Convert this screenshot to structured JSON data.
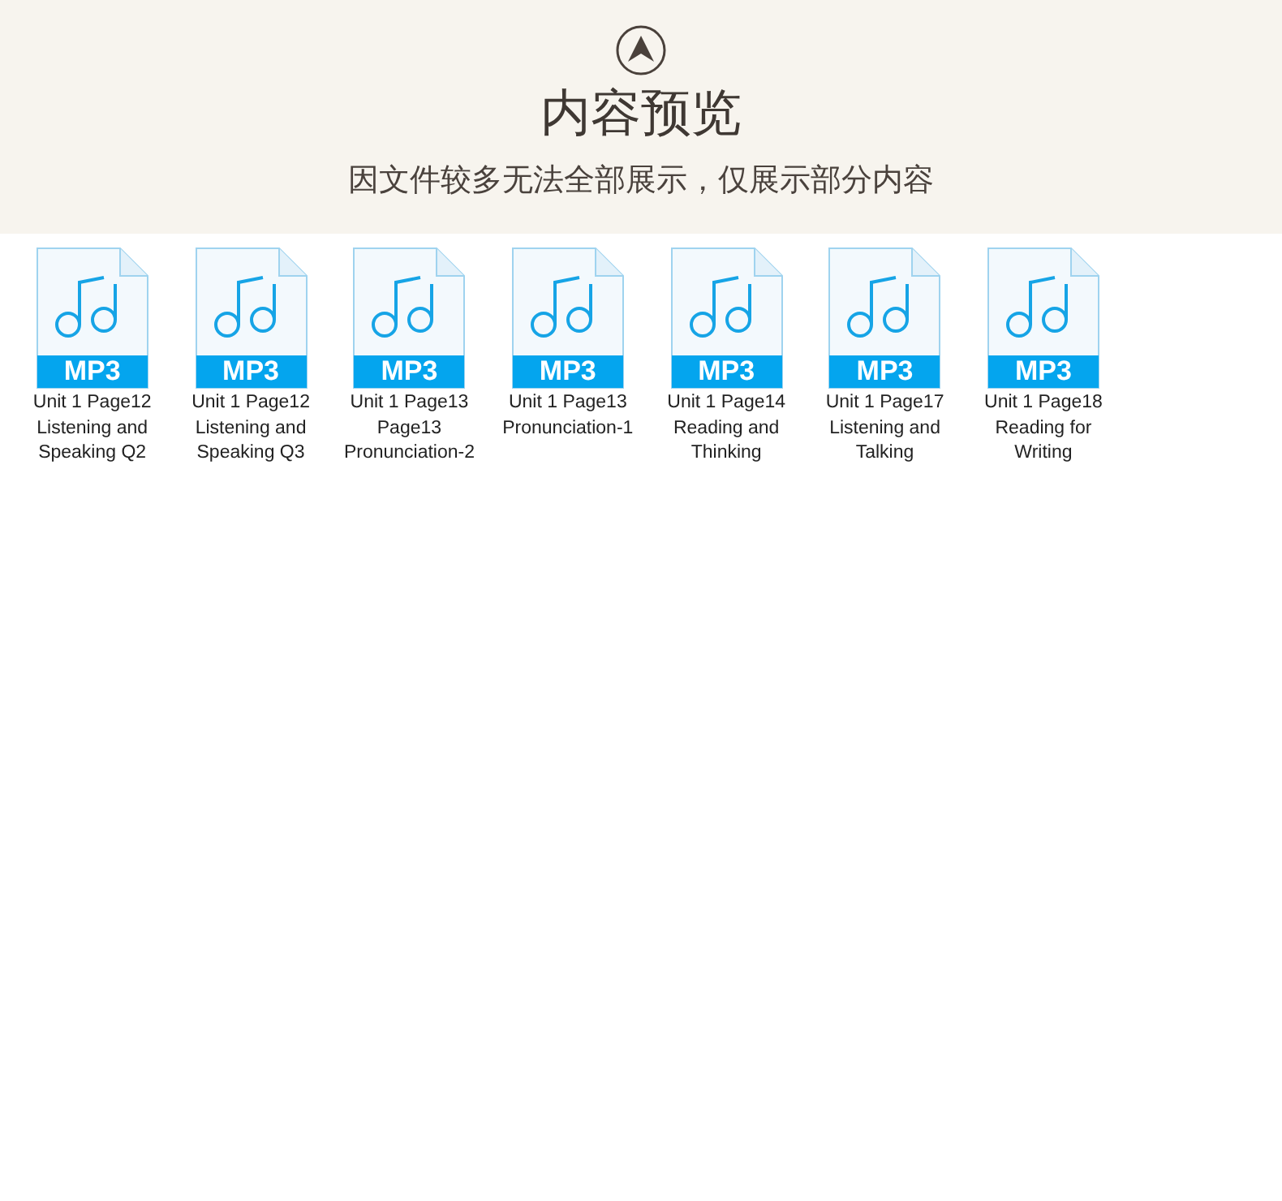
{
  "header": {
    "title": "内容预览",
    "subtitle": "因文件较多无法全部展示，仅展示部分内容"
  },
  "files": [
    {
      "badge": "MP3",
      "name_lines": [
        "Unit 1 Page12",
        "Listening and",
        "Speaking Q2"
      ]
    },
    {
      "badge": "MP3",
      "name_lines": [
        "Unit 1 Page12",
        "Listening and",
        "Speaking Q3"
      ]
    },
    {
      "badge": "MP3",
      "name_lines": [
        "Unit 1 Page13",
        "Page13",
        "Pronunciation-2"
      ]
    },
    {
      "badge": "MP3",
      "name_lines": [
        "Unit 1 Page13",
        "Pronunciation-1"
      ]
    },
    {
      "badge": "MP3",
      "name_lines": [
        "Unit 1 Page14",
        "Reading and",
        "Thinking"
      ]
    },
    {
      "badge": "MP3",
      "name_lines": [
        "Unit 1 Page17",
        "Listening and",
        "Talking"
      ]
    },
    {
      "badge": "MP3",
      "name_lines": [
        "Unit 1 Page18",
        "Reading for",
        "Writing"
      ]
    }
  ]
}
